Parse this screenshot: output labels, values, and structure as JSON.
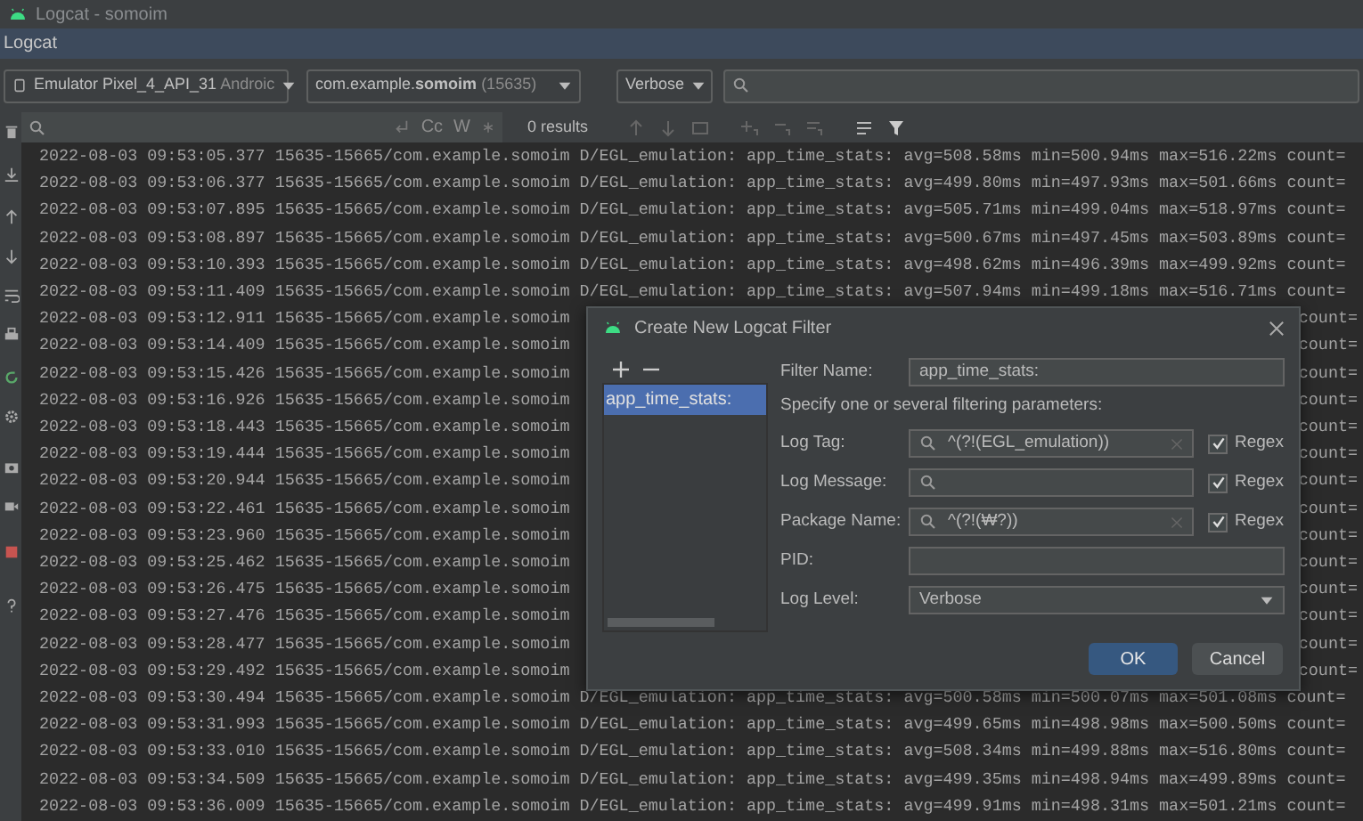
{
  "window": {
    "title": "Logcat - somoim"
  },
  "tool_window": {
    "title": "Logcat"
  },
  "toolbar": {
    "device": {
      "name": "Emulator Pixel_4_API_31",
      "suffix": "Androic"
    },
    "process": {
      "name": "com.example.**somoim**",
      "pid": "(15635)"
    },
    "level": "Verbose"
  },
  "find_bar": {
    "options": [
      "Cc",
      "W"
    ],
    "results": "0 results"
  },
  "log": [
    {
      "kind": "full",
      "prefix": "2022-08-03 09:53:05.377 15635-15665/com.example.somoim",
      "message": "D/EGL_emulation: app_time_stats: avg=508.58ms min=500.94ms max=516.22ms count="
    },
    {
      "kind": "full",
      "prefix": "2022-08-03 09:53:06.377 15635-15665/com.example.somoim",
      "message": "D/EGL_emulation: app_time_stats: avg=499.80ms min=497.93ms max=501.66ms count="
    },
    {
      "kind": "full",
      "prefix": "2022-08-03 09:53:07.895 15635-15665/com.example.somoim",
      "message": "D/EGL_emulation: app_time_stats: avg=505.71ms min=499.04ms max=518.97ms count="
    },
    {
      "kind": "full",
      "prefix": "2022-08-03 09:53:08.897 15635-15665/com.example.somoim",
      "message": "D/EGL_emulation: app_time_stats: avg=500.67ms min=497.45ms max=503.89ms count="
    },
    {
      "kind": "full",
      "prefix": "2022-08-03 09:53:10.393 15635-15665/com.example.somoim",
      "message": "D/EGL_emulation: app_time_stats: avg=498.62ms min=496.39ms max=499.92ms count="
    },
    {
      "kind": "full",
      "prefix": "2022-08-03 09:53:11.409 15635-15665/com.example.somoim",
      "message": "D/EGL_emulation: app_time_stats: avg=507.94ms min=499.18ms max=516.71ms count="
    },
    {
      "kind": "covered",
      "prefix": "2022-08-03 09:53:12.911 15635-15665/com.example.somoim",
      "message": "count="
    },
    {
      "kind": "covered",
      "prefix": "2022-08-03 09:53:14.409 15635-15665/com.example.somoim",
      "message": "count="
    },
    {
      "kind": "covered",
      "prefix": "2022-08-03 09:53:15.426 15635-15665/com.example.somoim",
      "message": "count="
    },
    {
      "kind": "covered",
      "prefix": "2022-08-03 09:53:16.926 15635-15665/com.example.somoim",
      "message": "count="
    },
    {
      "kind": "covered",
      "prefix": "2022-08-03 09:53:18.443 15635-15665/com.example.somoim",
      "message": "count="
    },
    {
      "kind": "covered",
      "prefix": "2022-08-03 09:53:19.444 15635-15665/com.example.somoim",
      "message": "count="
    },
    {
      "kind": "covered",
      "prefix": "2022-08-03 09:53:20.944 15635-15665/com.example.somoim",
      "message": "count="
    },
    {
      "kind": "covered",
      "prefix": "2022-08-03 09:53:22.461 15635-15665/com.example.somoim",
      "message": "count="
    },
    {
      "kind": "covered",
      "prefix": "2022-08-03 09:53:23.960 15635-15665/com.example.somoim",
      "message": "count="
    },
    {
      "kind": "covered",
      "prefix": "2022-08-03 09:53:25.462 15635-15665/com.example.somoim",
      "message": "count="
    },
    {
      "kind": "covered",
      "prefix": "2022-08-03 09:53:26.475 15635-15665/com.example.somoim",
      "message": "count="
    },
    {
      "kind": "covered",
      "prefix": "2022-08-03 09:53:27.476 15635-15665/com.example.somoim",
      "message": "count="
    },
    {
      "kind": "covered",
      "prefix": "2022-08-03 09:53:28.477 15635-15665/com.example.somoim",
      "message": "count="
    },
    {
      "kind": "covered",
      "prefix": "2022-08-03 09:53:29.492 15635-15665/com.example.somoim",
      "message": "count="
    },
    {
      "kind": "full",
      "prefix": "2022-08-03 09:53:30.494 15635-15665/com.example.somoim",
      "message": "D/EGL_emulation: app_time_stats: avg=500.58ms min=500.07ms max=501.08ms count="
    },
    {
      "kind": "full",
      "prefix": "2022-08-03 09:53:31.993 15635-15665/com.example.somoim",
      "message": "D/EGL_emulation: app_time_stats: avg=499.65ms min=498.98ms max=500.50ms count="
    },
    {
      "kind": "full",
      "prefix": "2022-08-03 09:53:33.010 15635-15665/com.example.somoim",
      "message": "D/EGL_emulation: app_time_stats: avg=508.34ms min=499.88ms max=516.80ms count="
    },
    {
      "kind": "full",
      "prefix": "2022-08-03 09:53:34.509 15635-15665/com.example.somoim",
      "message": "D/EGL_emulation: app_time_stats: avg=499.35ms min=498.94ms max=499.89ms count="
    },
    {
      "kind": "full",
      "prefix": "2022-08-03 09:53:36.009 15635-15665/com.example.somoim",
      "message": "D/EGL_emulation: app_time_stats: avg=499.91ms min=498.31ms max=501.21ms count="
    }
  ],
  "dialog": {
    "title": "Create New Logcat Filter",
    "filters": [
      {
        "label": "app_time_stats:",
        "selected": true
      }
    ],
    "filter_name": {
      "label": "Filter Name:",
      "value": "app_time_stats:"
    },
    "hint": "Specify one or several filtering parameters:",
    "fields": [
      {
        "kind": "search",
        "label": "Log Tag:",
        "value": "^(?!(EGL_emulation))",
        "regex": {
          "label": "Regex",
          "checked": true
        }
      },
      {
        "kind": "search",
        "label": "Log Message:",
        "regex": {
          "label": "Regex",
          "checked": true
        }
      },
      {
        "kind": "search",
        "label": "Package Name:",
        "value": "^(?!(₩?))",
        "regex": {
          "label": "Regex",
          "checked": true
        }
      },
      {
        "kind": "text",
        "label": "PID:"
      },
      {
        "kind": "select",
        "label": "Log Level:",
        "value": "Verbose"
      }
    ],
    "buttons": [
      {
        "label": "OK",
        "primary": true
      },
      {
        "label": "Cancel",
        "primary": false
      }
    ]
  }
}
